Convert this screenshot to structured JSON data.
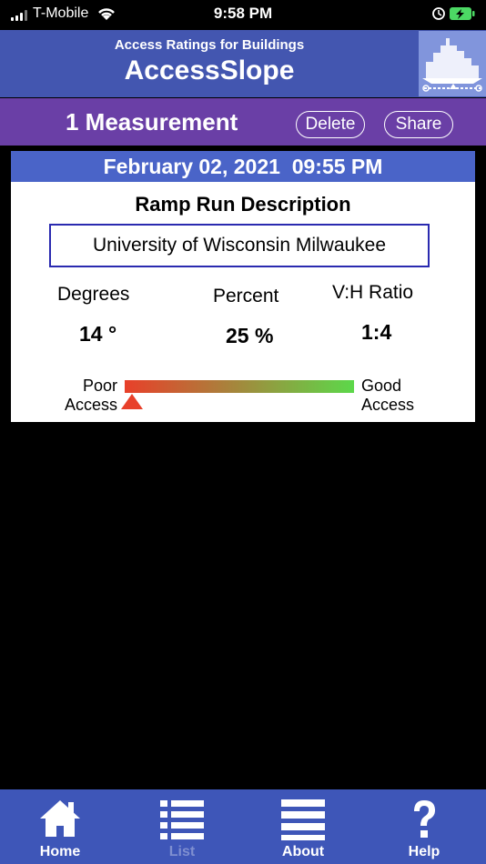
{
  "status_bar": {
    "carrier": "T-Mobile",
    "time": "9:58 PM"
  },
  "header": {
    "subtitle": "Access Ratings for Buildings",
    "title": "AccessSlope",
    "logo_icon": "building-ramp-logo"
  },
  "sub_header": {
    "count_label": "1 Measurement",
    "delete_label": "Delete",
    "share_label": "Share"
  },
  "measurement": {
    "date": "February 02, 2021  09:55 PM",
    "description_label": "Ramp Run Description",
    "description": "University of Wisconsin Milwaukee",
    "degrees_label": "Degrees",
    "degrees_value": "14 °",
    "percent_label": "Percent",
    "percent_value": "25 %",
    "ratio_label": "V:H Ratio",
    "ratio_value": "1:4",
    "gauge_poor": "Poor\nAccess",
    "gauge_good": "Good\nAccess",
    "gauge_level": 0.03
  },
  "tabs": [
    {
      "label": "Home",
      "icon": "home-icon"
    },
    {
      "label": "List",
      "icon": "list-icon"
    },
    {
      "label": "About",
      "icon": "menu-icon"
    },
    {
      "label": "Help",
      "icon": "help-icon"
    }
  ],
  "colors": {
    "header": "#4356b0",
    "sub_header": "#6a3fa6",
    "date_bar": "#4a64c8",
    "tab_bar": "#3e56b8",
    "poor": "#e8402a",
    "good": "#5cd84a"
  }
}
